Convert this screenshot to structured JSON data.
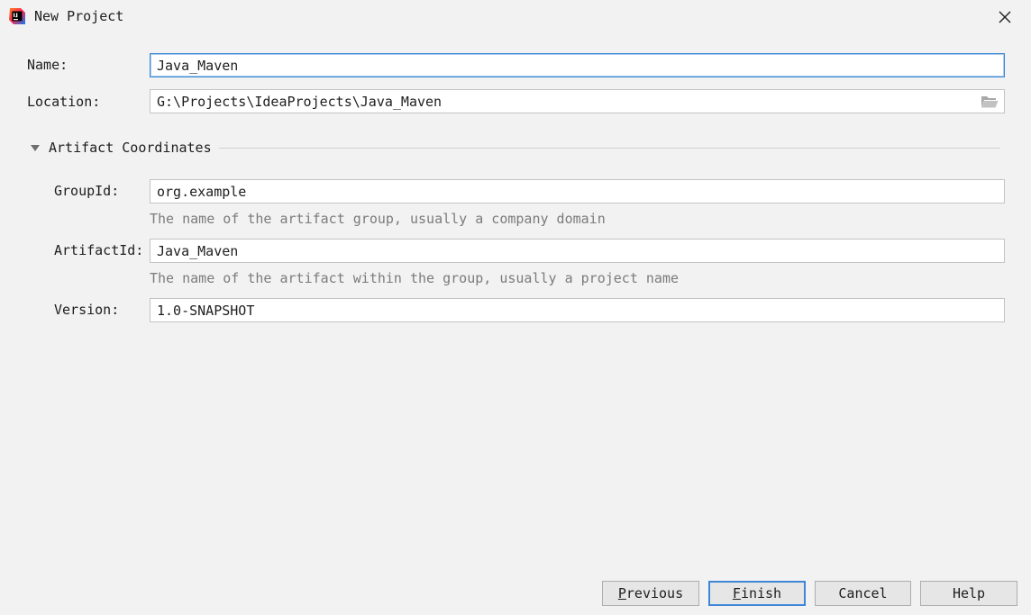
{
  "window": {
    "title": "New Project"
  },
  "form": {
    "name_label": "Name:",
    "name_value": "Java_Maven",
    "location_label": "Location:",
    "location_value": "G:\\Projects\\IdeaProjects\\Java_Maven"
  },
  "artifact": {
    "section_title": "Artifact Coordinates",
    "group_label": "GroupId:",
    "group_value": "org.example",
    "group_hint": "The name of the artifact group, usually a company domain",
    "artifact_label": "ArtifactId:",
    "artifact_value": "Java_Maven",
    "artifact_hint": "The name of the artifact within the group, usually a project name",
    "version_label": "Version:",
    "version_value": "1.0-SNAPSHOT"
  },
  "buttons": {
    "previous_mnemonic": "P",
    "previous_rest": "revious",
    "finish_mnemonic": "F",
    "finish_rest": "inish",
    "cancel": "Cancel",
    "help": "Help"
  },
  "icons": {
    "app": "intellij-idea-icon",
    "close": "close-icon",
    "folder": "folder-open-icon",
    "collapse": "triangle-down-icon"
  },
  "colors": {
    "focus_accent": "#3d87d6",
    "background": "#f2f2f2",
    "hint": "#7b7b7b"
  }
}
